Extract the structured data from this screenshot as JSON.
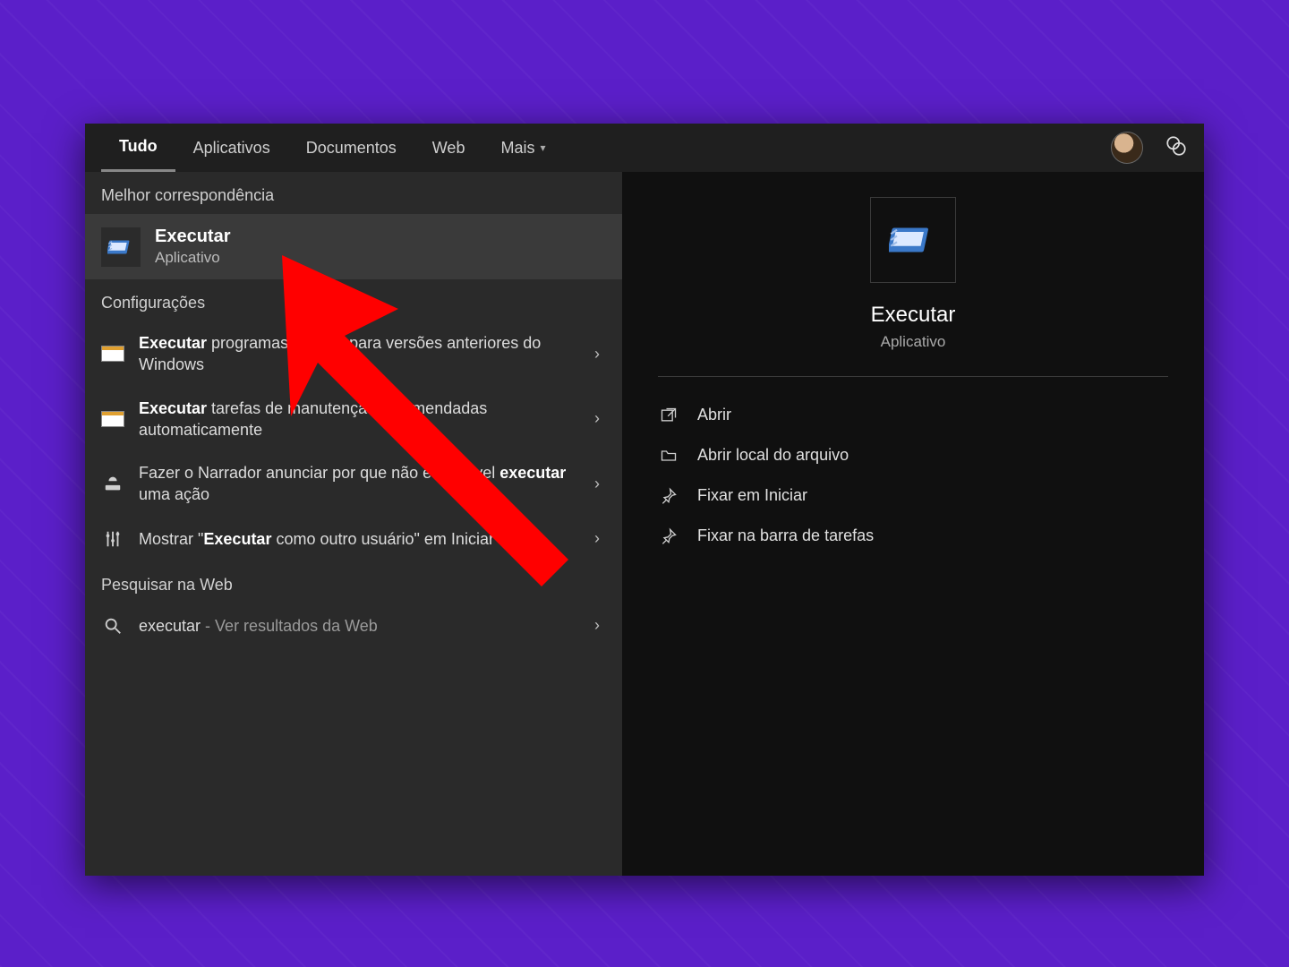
{
  "tabs": {
    "items": [
      {
        "label": "Tudo",
        "active": true
      },
      {
        "label": "Aplicativos",
        "active": false
      },
      {
        "label": "Documentos",
        "active": false
      },
      {
        "label": "Web",
        "active": false
      },
      {
        "label": "Mais",
        "active": false,
        "has_dropdown": true
      }
    ]
  },
  "left": {
    "best_match_header": "Melhor correspondência",
    "best_match": {
      "title": "Executar",
      "subtitle": "Aplicativo"
    },
    "settings_header": "Configurações",
    "settings": [
      {
        "prefix": "Executar",
        "rest": " programas criados para versões anteriores do Windows"
      },
      {
        "prefix": "Executar",
        "rest": " tarefas de manutenção recomendadas automaticamente"
      },
      {
        "plain_pre": "Fazer o Narrador anunciar por que não é possível ",
        "bold": "executar",
        "plain_post": " uma ação"
      },
      {
        "plain_pre": "Mostrar \"",
        "bold": "Executar",
        "plain_post": " como outro usuário\" em Iniciar"
      }
    ],
    "web_header": "Pesquisar na Web",
    "web": {
      "query": "executar",
      "suffix": " - Ver resultados da Web"
    }
  },
  "preview": {
    "title": "Executar",
    "subtitle": "Aplicativo",
    "actions": [
      {
        "label": "Abrir",
        "icon": "open"
      },
      {
        "label": "Abrir local do arquivo",
        "icon": "folder"
      },
      {
        "label": "Fixar em Iniciar",
        "icon": "pin"
      },
      {
        "label": "Fixar na barra de tarefas",
        "icon": "pin"
      }
    ]
  }
}
